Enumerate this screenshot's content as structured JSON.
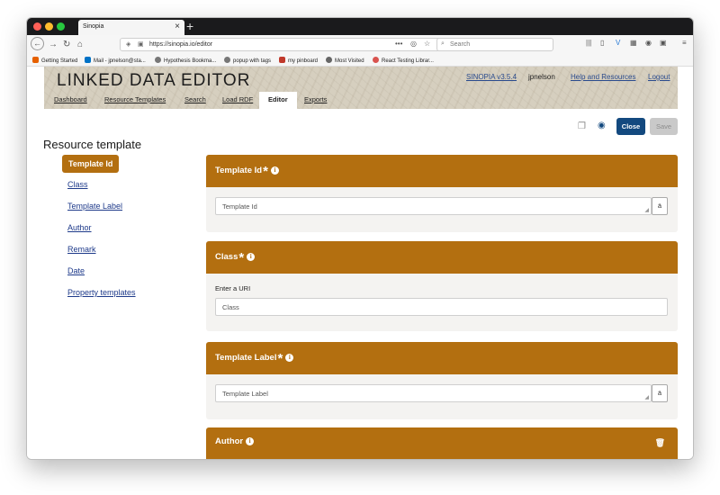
{
  "browser": {
    "tab_title": "Sinopia",
    "tab_close": "×",
    "new_tab": "+",
    "url": "https://sinopia.io/editor",
    "url_menu": "•••",
    "search_placeholder": "Search"
  },
  "bookmarks": [
    {
      "label": "Getting Started",
      "color": "#e66000"
    },
    {
      "label": "Mail - jpnelson@sta...",
      "color": "#0072c6"
    },
    {
      "label": "Hypothesis Bookma...",
      "color": "#555555"
    },
    {
      "label": "popup with tags",
      "color": "#555555"
    },
    {
      "label": "my pinboard",
      "color": "#c0392b"
    },
    {
      "label": "Most Visited",
      "color": "#555555"
    },
    {
      "label": "React Testing Librar...",
      "color": "#d9534f"
    }
  ],
  "app": {
    "logo": "LINKED DATA EDITOR",
    "version_link": "SINOPIA v3.5.4",
    "username": "jpnelson",
    "help_link": "Help and Resources",
    "logout_link": "Logout",
    "nav_tabs": [
      "Dashboard",
      "Resource Templates",
      "Search",
      "Load RDF",
      "Editor",
      "Exports"
    ],
    "active_tab": "Editor",
    "close_button": "Close",
    "save_button": "Save"
  },
  "page": {
    "title": "Resource template",
    "left_nav": [
      "Template Id",
      "Class",
      "Template Label",
      "Author",
      "Remark",
      "Date",
      "Property templates"
    ],
    "active_nav": "Template Id"
  },
  "panels": [
    {
      "title": "Template Id",
      "required": "*",
      "info": "i",
      "field_placeholder": "Template Id",
      "lang": "ä"
    },
    {
      "title": "Class",
      "required": "*",
      "info": "i",
      "field_label": "Enter a URI",
      "field_placeholder": "Class"
    },
    {
      "title": "Template Label",
      "required": "*",
      "info": "i",
      "field_placeholder": "Template Label",
      "lang": "ä"
    },
    {
      "title": "Author",
      "info": "i"
    }
  ],
  "colors": {
    "accent": "#b36f10",
    "primary_button": "#13497f",
    "link": "#1e3a8a"
  }
}
